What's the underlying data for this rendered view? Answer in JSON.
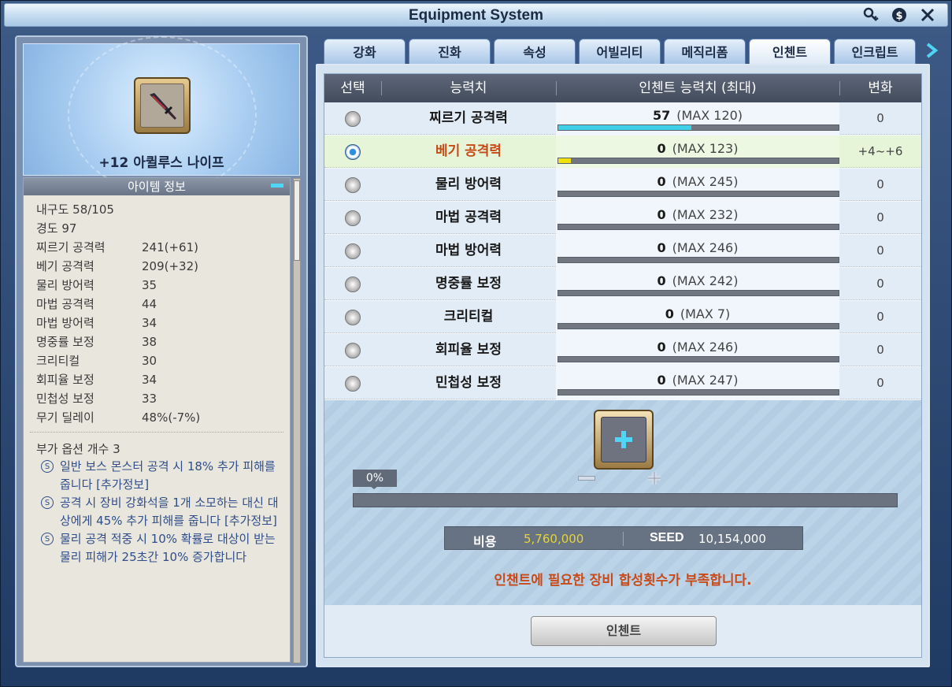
{
  "window": {
    "title": "Equipment System",
    "icons": [
      "key-icon",
      "seed-icon",
      "close-icon"
    ]
  },
  "item": {
    "name": "+12 아퀼루스 나이프"
  },
  "info": {
    "header": "아이템 정보",
    "stats": [
      {
        "name": "내구도 58/105",
        "value": ""
      },
      {
        "name": "경도 97",
        "value": ""
      },
      {
        "name": "찌르기 공격력",
        "value": "241(+61)"
      },
      {
        "name": "베기 공격력",
        "value": "209(+32)"
      },
      {
        "name": "물리 방어력",
        "value": "35"
      },
      {
        "name": "마법 공격력",
        "value": "44"
      },
      {
        "name": "마법 방어력",
        "value": "34"
      },
      {
        "name": "명중률 보정",
        "value": "38"
      },
      {
        "name": "크리티컬",
        "value": "30"
      },
      {
        "name": "회피율 보정",
        "value": "34"
      },
      {
        "name": "민첩성 보정",
        "value": "33"
      },
      {
        "name": "무기 딜레이",
        "value": "48%(-7%)"
      }
    ],
    "option_count": "부가 옵션 개수 3",
    "options": [
      {
        "badge": "S",
        "text": "일반 보스 몬스터 공격 시 18% 추가 피해를 줍니다 [추가정보]"
      },
      {
        "badge": "S",
        "text": "공격 시 장비 강화석을 1개 소모하는 대신 대상에게 45% 추가 피해를 줍니다 [추가정보]"
      },
      {
        "badge": "S",
        "text": "물리 공격 적중 시 10% 확률로 대상이 받는 물리 피해가 25초간 10% 증가합니다"
      }
    ]
  },
  "tabs": [
    {
      "label": "강화",
      "active": false
    },
    {
      "label": "진화",
      "active": false
    },
    {
      "label": "속성",
      "active": false
    },
    {
      "label": "어빌리티",
      "active": false
    },
    {
      "label": "메직리폼",
      "active": false
    },
    {
      "label": "인첸트",
      "active": true
    },
    {
      "label": "인크립트",
      "active": false
    }
  ],
  "table": {
    "headers": {
      "select": "선택",
      "stat": "능력치",
      "enchant": "인첸트 능력치 (최대)",
      "change": "변화"
    },
    "rows": [
      {
        "name": "찌르기 공격력",
        "value": "57",
        "max": "(MAX 120)",
        "fill": 0.475,
        "fill_color": "#3fd0e8",
        "change": "0",
        "selected": false
      },
      {
        "name": "베기 공격력",
        "value": "0",
        "max": "(MAX 123)",
        "fill": 0.045,
        "fill_color": "#f2e20c",
        "change": "+4~+6",
        "selected": true
      },
      {
        "name": "물리 방어력",
        "value": "0",
        "max": "(MAX 245)",
        "fill": 0,
        "fill_color": "#3fd0e8",
        "change": "0",
        "selected": false
      },
      {
        "name": "마법 공격력",
        "value": "0",
        "max": "(MAX 232)",
        "fill": 0,
        "fill_color": "#3fd0e8",
        "change": "0",
        "selected": false
      },
      {
        "name": "마법 방어력",
        "value": "0",
        "max": "(MAX 246)",
        "fill": 0,
        "fill_color": "#3fd0e8",
        "change": "0",
        "selected": false
      },
      {
        "name": "명중률 보정",
        "value": "0",
        "max": "(MAX 242)",
        "fill": 0,
        "fill_color": "#3fd0e8",
        "change": "0",
        "selected": false
      },
      {
        "name": "크리티컬",
        "value": "0",
        "max": "(MAX 7)",
        "fill": 0,
        "fill_color": "#3fd0e8",
        "change": "0",
        "selected": false
      },
      {
        "name": "회피율 보정",
        "value": "0",
        "max": "(MAX 246)",
        "fill": 0,
        "fill_color": "#3fd0e8",
        "change": "0",
        "selected": false
      },
      {
        "name": "민첩성 보정",
        "value": "0",
        "max": "(MAX 247)",
        "fill": 0,
        "fill_color": "#3fd0e8",
        "change": "0",
        "selected": false
      }
    ]
  },
  "enchant": {
    "percent": "0%",
    "cost_label": "비용",
    "cost_value": "5,760,000",
    "seed_label": "SEED",
    "seed_value": "10,154,000",
    "warning": "인챈트에 필요한 장비 합성횟수가 부족합니다.",
    "button_label": "인첸트"
  },
  "colors": {
    "accent_cyan": "#3fd0e8",
    "selected_row": "#e6f5d8",
    "warning": "#c84a18",
    "cost_gold": "#e5d43a"
  }
}
